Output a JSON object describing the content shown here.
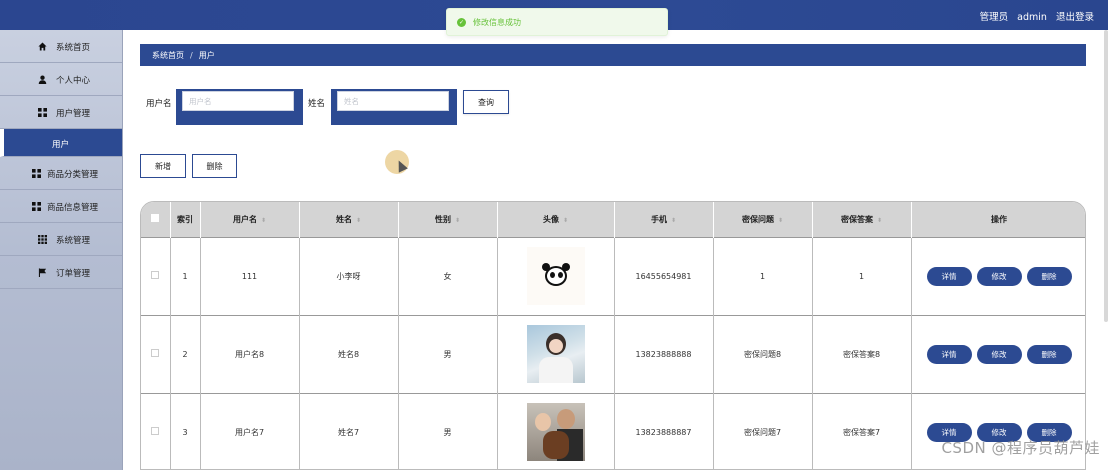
{
  "header": {
    "user_role": "管理员",
    "username": "admin",
    "logout": "退出登录"
  },
  "toast": {
    "message": "修改信息成功"
  },
  "sidebar": {
    "items": [
      {
        "label": "系统首页",
        "icon": "home-icon"
      },
      {
        "label": "个人中心",
        "icon": "user-icon"
      },
      {
        "label": "用户管理",
        "icon": "grid-icon"
      },
      {
        "label": "用户",
        "icon": "",
        "active": true
      },
      {
        "label": "商品分类管理",
        "icon": "grid-icon"
      },
      {
        "label": "商品信息管理",
        "icon": "grid-icon"
      },
      {
        "label": "系统管理",
        "icon": "grid-9-icon"
      },
      {
        "label": "订单管理",
        "icon": "flag-icon"
      }
    ]
  },
  "breadcrumb": {
    "home": "系统首页",
    "separator": "/",
    "current": "用户"
  },
  "search": {
    "username_label": "用户名",
    "username_placeholder": "用户名",
    "name_label": "姓名",
    "name_placeholder": "姓名",
    "query_button": "查询"
  },
  "toolbar": {
    "add_button": "新增",
    "delete_button": "删除"
  },
  "table": {
    "columns": [
      "索引",
      "用户名",
      "姓名",
      "性别",
      "头像",
      "手机",
      "密保问题",
      "密保答案",
      "操作"
    ],
    "rows": [
      {
        "index": "1",
        "username": "111",
        "name": "小李呀",
        "gender": "女",
        "avatar": "panda-avatar",
        "phone": "16455654981",
        "question": "1",
        "answer": "1"
      },
      {
        "index": "2",
        "username": "用户名8",
        "name": "姓名8",
        "gender": "男",
        "avatar": "girl-photo-avatar",
        "phone": "13823888888",
        "question": "密保问题8",
        "answer": "密保答案8"
      },
      {
        "index": "3",
        "username": "用户名7",
        "name": "姓名7",
        "gender": "男",
        "avatar": "couple-dog-photo-avatar",
        "phone": "13823888887",
        "question": "密保问题7",
        "answer": "密保答案7"
      }
    ],
    "actions": {
      "detail": "详情",
      "edit": "修改",
      "delete": "删除"
    }
  },
  "watermark": "CSDN @程序员葫芦娃",
  "colors": {
    "primary": "#2c4a92",
    "success": "#67c23a"
  }
}
